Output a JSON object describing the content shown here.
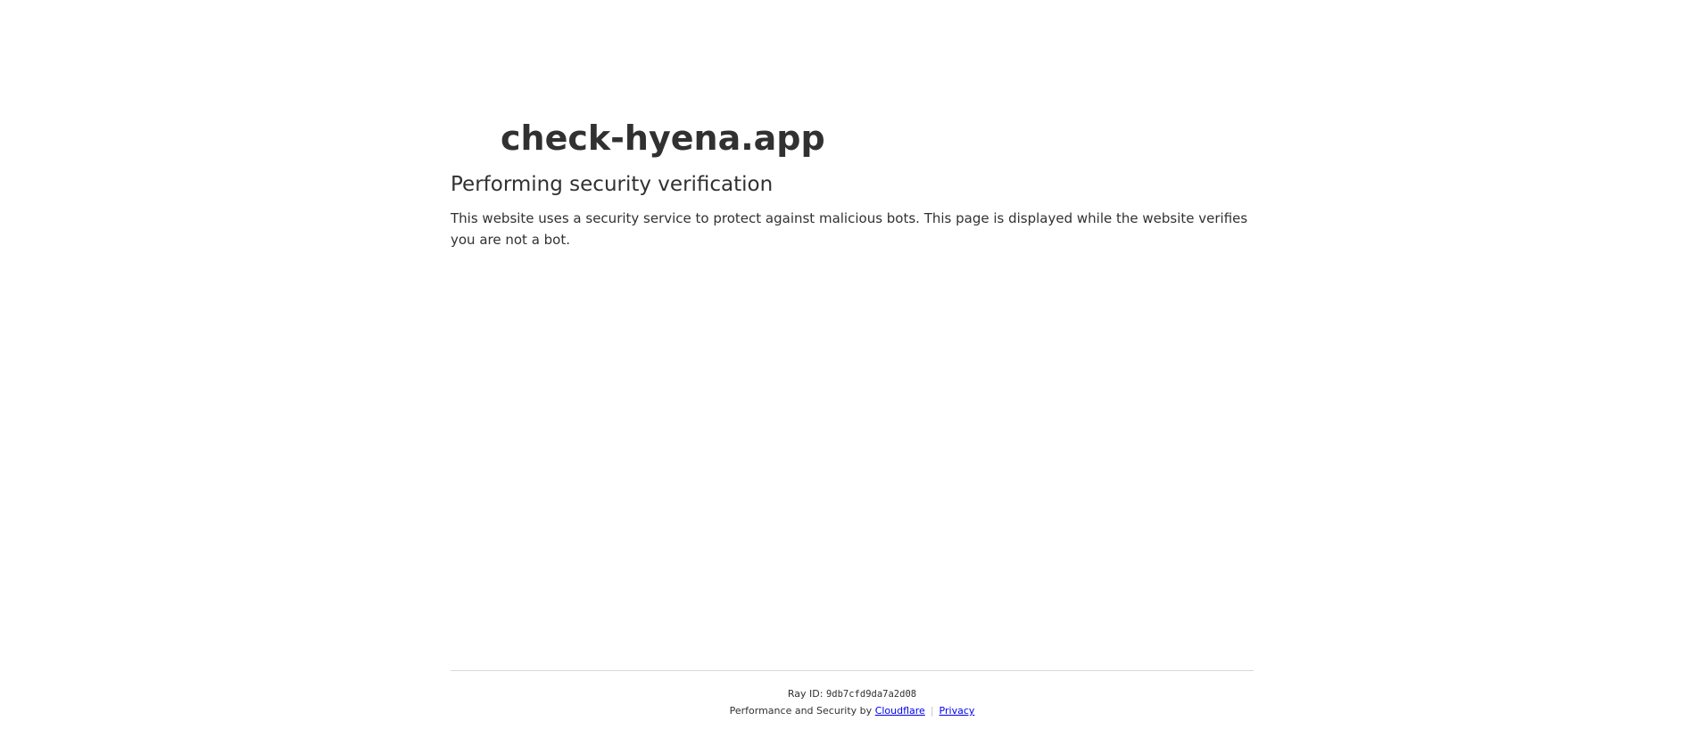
{
  "site": {
    "title": "check-hyena.app",
    "favicon_icon": "site-favicon-icon"
  },
  "main": {
    "heading": "Performing security verification",
    "description": "This website uses a security service to protect against malicious bots. This page is displayed while the website verifies you are not a bot."
  },
  "footer": {
    "ray_label": "Ray ID: ",
    "ray_id": "9db7cfd9da7a2d08",
    "credits_prefix": "Performance and Security by ",
    "cloudflare_link": "Cloudflare",
    "separator": "|",
    "privacy_link": "Privacy"
  },
  "colors": {
    "text": "#313131",
    "link": "#0000ee",
    "divider": "#d9d9d9",
    "background": "#ffffff"
  }
}
